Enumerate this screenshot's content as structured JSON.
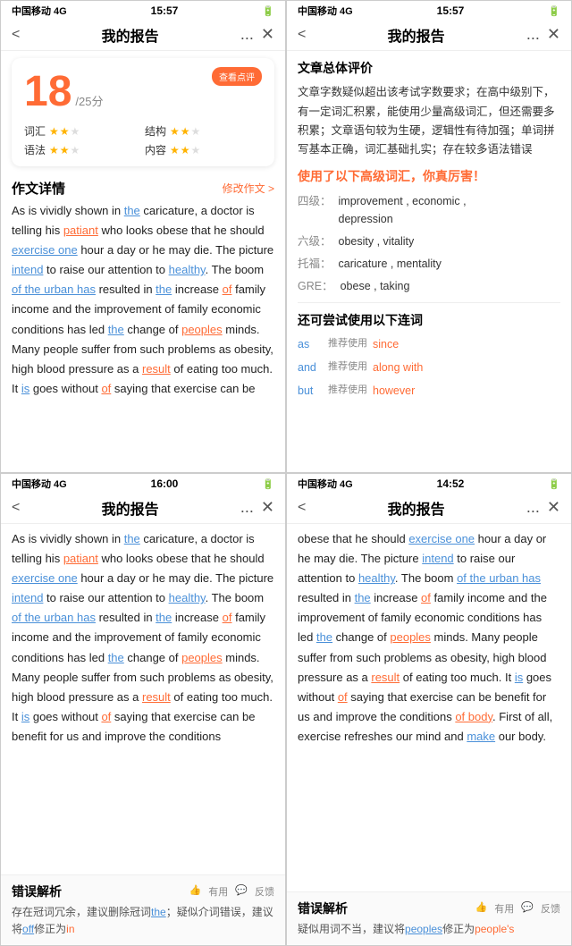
{
  "screens": {
    "top_left": {
      "status": {
        "carrier": "中国移动 4G",
        "time": "15:57",
        "battery": "□"
      },
      "nav": {
        "back": "<",
        "title": "我的报告",
        "more": "...",
        "close": "✕"
      },
      "score_card": {
        "review_btn": "查看点评",
        "score": "18",
        "score_total": "/25分",
        "items": [
          {
            "label": "词汇",
            "stars": 2,
            "total": 3
          },
          {
            "label": "结构",
            "stars": 2,
            "total": 3
          },
          {
            "label": "语法",
            "stars": 2,
            "total": 3
          },
          {
            "label": "内容",
            "stars": 2,
            "total": 3
          }
        ]
      },
      "essay_section": {
        "title": "作文详情",
        "edit_link": "修改作文 >"
      },
      "essay_text": "As is vividly shown in the caricature, a doctor is telling his patiant who looks obese that he should exercise one hour a day or he may die. The picture intend to raise our attention to healthy. The boom of the urban has resulted in the increase of family income and the improvement of family economic conditions has led the change of peoples minds. Many people suffer from such problems as obesity, high blood pressure as a result of eating too much. It is goes without of saying that exercise can be"
    },
    "top_right": {
      "status": {
        "carrier": "中国移动 4G",
        "time": "15:57",
        "battery": "□"
      },
      "nav": {
        "back": "<",
        "title": "我的报告",
        "more": "...",
        "close": "✕"
      },
      "overall_title": "文章总体评价",
      "overall_text": "文章字数疑似超出该考试字数要求；在高中级别下，有一定词汇积累，能使用少量高级词汇，但还需要多积累；文章语句较为生硬，逻辑性有待加强；单词拼写基本正确，词汇基础扎实；存在较多语法错误",
      "vocab_title": "使用了以下高级词汇，你真厉害！",
      "vocab_items": [
        {
          "label": "四级：",
          "words": "improvement , economic , depression"
        },
        {
          "label": "六级：",
          "words": "obesity , vitality"
        },
        {
          "label": "托福：",
          "words": "caricature , mentality"
        },
        {
          "label": "GRE：",
          "words": "obese , taking"
        }
      ],
      "connective_title": "还可尝试使用以下连词",
      "connective_items": [
        {
          "word": "as",
          "suggest": "推荐使用",
          "recommend": "since"
        },
        {
          "word": "and",
          "suggest": "推荐使用",
          "recommend": "along with"
        },
        {
          "word": "but",
          "suggest": "推荐使用",
          "recommend": "however"
        }
      ]
    },
    "bottom_left": {
      "status": {
        "carrier": "中国移动 4G",
        "time": "16:00",
        "battery": "□"
      },
      "nav": {
        "back": "<",
        "title": "我的报告",
        "more": "...",
        "close": "✕"
      },
      "essay_text": "As is vividly shown in the caricature, a doctor is telling his patiant who looks obese that he should exercise one hour a day or he may die. The picture intend to raise our attention to healthy. The boom of the urban has resulted in the increase of family income and the improvement of family economic conditions has led the change of peoples minds. Many people suffer from such problems as obesity, high blood pressure as a result of eating too much. It is goes without of saying that exercise can be benefit for us and improve the conditions",
      "error_title": "错误解析",
      "error_useful": "有用",
      "error_feedback": "反馈",
      "error_text": "存在冠词冗余，建议删除冠词the；疑似介词错误，建议将off修正为in"
    },
    "bottom_right": {
      "status": {
        "carrier": "中国移动 4G",
        "time": "14:52",
        "battery": "□"
      },
      "nav": {
        "back": "<",
        "title": "我的报告",
        "more": "...",
        "close": "✕"
      },
      "essay_text": "obese that he should exercise one hour a day or he may die. The picture intend to raise our attention to healthy. The boom of the urban has resulted in the increase of family income and the improvement of family economic conditions has led the change of peoples minds. Many people suffer from such problems as obesity, high blood pressure as a result of eating too much. It is goes without of saying that exercise can be benefit for us and improve the conditions of body. First of all, exercise refreshes our mind and make our body.",
      "error_title": "错误解析",
      "error_useful": "有用",
      "error_feedback": "反馈",
      "error_text": "疑似用词不当，建议将peoples修正为people's"
    }
  }
}
